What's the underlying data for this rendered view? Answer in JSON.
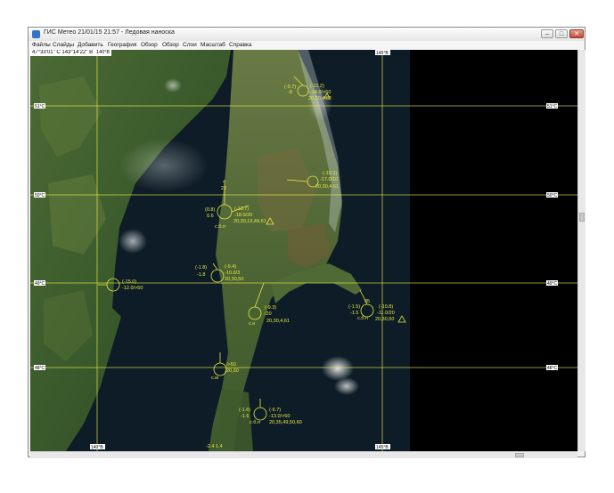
{
  "window": {
    "title": "ГИС Метео 21/01/15 21:57 - Ледовая наноска",
    "buttons": {
      "minimize": "–",
      "maximize": "□",
      "close": "✕"
    }
  },
  "menu": [
    "Файлы",
    "Слайды",
    "Добавить",
    "География",
    "Обзор",
    "Обзор",
    "Слои",
    "Масштаб",
    "Справка"
  ],
  "status": {
    "cursor_coords": "47°33'01\" С 143°14'22\" В",
    "lon_tag": "140°В"
  },
  "colors": {
    "grid": "#e8e845",
    "symbols": "#e8e845",
    "sea": "#0a1a22",
    "land": "#2f4a22"
  },
  "map": {
    "lat_labels": [
      "51°С",
      "50°С",
      "49°С",
      "48°С"
    ],
    "lon_labels": [
      "140°В",
      "145°В"
    ],
    "stations": [
      {
        "id": "s1",
        "lines": [
          "(-11.2)",
          "-14.0/>50",
          "20,30,4,62"
        ],
        "left": [
          "(-9.7)",
          "-8"
        ]
      },
      {
        "id": "s2",
        "lines": [
          "(-10.3)",
          "-17.0/10",
          "20,30,4,61"
        ]
      },
      {
        "id": "s3",
        "left": [
          "(0.8)",
          "0.6"
        ],
        "top": [
          "4",
          "22"
        ],
        "lines": [
          "(-13.7)",
          "-18.0/20",
          "20,30,12,49,61"
        ],
        "bottom": "с.б.п"
      },
      {
        "id": "s4",
        "lines": [
          "(-15.0)",
          "-12.0/>50"
        ]
      },
      {
        "id": "s5",
        "left": [
          "(-1.8)",
          "-1.8"
        ],
        "lines": [
          "(-9.4)",
          "-10.0/3",
          "20,30,50"
        ]
      },
      {
        "id": "s6",
        "lines": [
          "(-9.3)",
          "/20",
          "20,30,4,61"
        ],
        "bottom": "с.н"
      },
      {
        "id": "s7",
        "left": [
          "(-1.5)",
          "-1.5"
        ],
        "top": "35",
        "lines": [
          "(-10.8)",
          "-11.0/20",
          "20,30,50"
        ],
        "bottom": "с.б.п"
      },
      {
        "id": "s8",
        "lines": [
          "/>50",
          "20,30"
        ],
        "bottom": "с.м"
      },
      {
        "id": "s9",
        "left": [
          "(-1.6)",
          "-1.6"
        ],
        "lines": [
          "(-6.7)",
          "-13.0/>50",
          "20,35,49,50,60"
        ],
        "bottom": "с.б.п"
      },
      {
        "id": "s10",
        "lines": [
          "-2.4 1.4"
        ]
      }
    ]
  }
}
